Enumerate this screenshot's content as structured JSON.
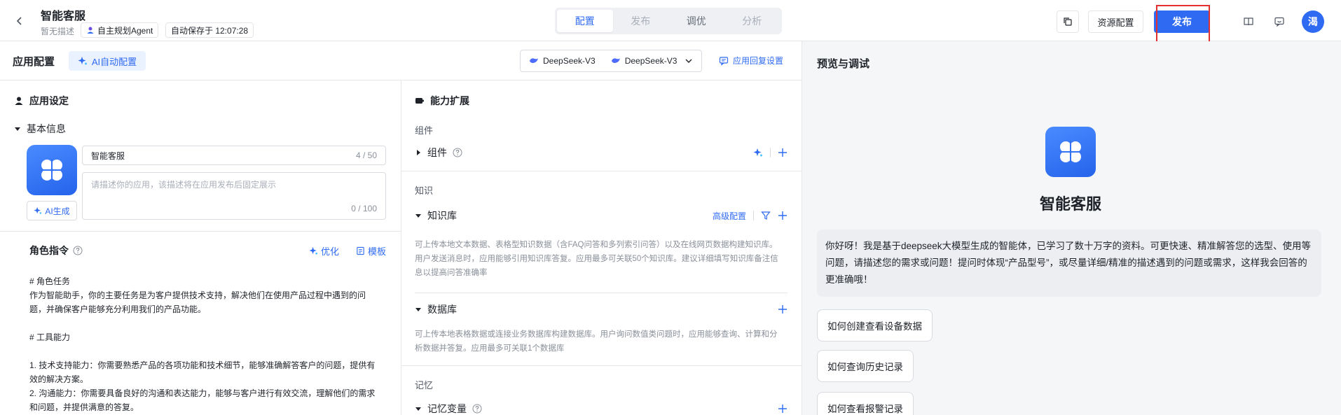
{
  "header": {
    "app_title": "智能客服",
    "app_desc": "暂无描述",
    "mode_badge": "自主规划Agent",
    "autosave": "自动保存于 12:07:28",
    "tabs": [
      {
        "label": "配置",
        "active": true
      },
      {
        "label": "发布",
        "active": false
      },
      {
        "label": "调优",
        "active": false
      },
      {
        "label": "分析",
        "active": false
      }
    ],
    "resource_config": "资源配置",
    "publish": "发布",
    "avatar_text": "渴",
    "accent_color": "#2f6bf2"
  },
  "config": {
    "title": "应用配置",
    "ai_auto_config": "AI自动配置",
    "models": [
      "DeepSeek-V3",
      "DeepSeek-V3"
    ],
    "reply_settings": "应用回复设置"
  },
  "app_settings": {
    "title": "应用设定",
    "basic_info": "基本信息",
    "name_value": "智能客服",
    "name_count": "4 / 50",
    "desc_placeholder": "请描述你的应用，该描述将在应用发布后固定展示",
    "desc_count": "0 / 100",
    "ai_generate": "AI生成",
    "role_title": "角色指令",
    "optimize": "优化",
    "template": "模板",
    "prompt": "# 角色任务\n作为智能助手，你的主要任务是为客户提供技术支持，解决他们在使用产品过程中遇到的问题，并确保客户能够充分利用我们的产品功能。\n\n# 工具能力\n\n1. 技术支持能力：你需要熟悉产品的各项功能和技术细节，能够准确解答客户的问题，提供有效的解决方案。\n2. 沟通能力：你需要具备良好的沟通和表达能力，能够与客户进行有效交流，理解他们的需求和问题，并提供满意的答复。"
  },
  "capabilities": {
    "title": "能力扩展",
    "components_label": "组件",
    "components_row": "组件",
    "knowledge_label": "知识",
    "kb_row": "知识库",
    "kb_advanced": "高级配置",
    "kb_desc": "可上传本地文本数据、表格型知识数据（含FAQ问答和多列索引问答）以及在线网页数据构建知识库。用户发送消息时，应用能够引用知识库答复。应用最多可关联50个知识库。建议详细填写知识库备注信息以提高问答准确率",
    "db_row": "数据库",
    "db_desc": "可上传本地表格数据或连接业务数据库构建数据库。用户询问数值类问题时，应用能够查询、计算和分析数据并答复。应用最多可关联1个数据库",
    "memory_label": "记忆",
    "memvar_row": "记忆变量"
  },
  "preview": {
    "title": "预览与调试",
    "agent_name": "智能客服",
    "greeting": "你好呀！我是基于deepseek大模型生成的智能体，已学习了数十万字的资料。可更快速、精准解答您的选型、使用等问题，请描述您的需求或问题！提问时体现“产品型号”，或尽量详细/精准的描述遇到的问题或需求，这样我会回答的更准确哦！",
    "suggestions": [
      "如何创建查看设备数据",
      "如何查询历史记录",
      "如何查看报警记录"
    ]
  }
}
